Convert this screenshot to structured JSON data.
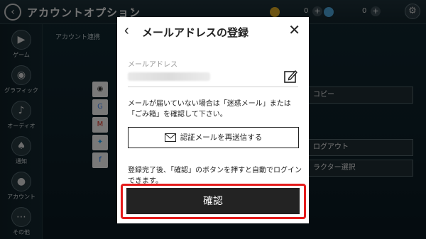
{
  "background": {
    "page_title": "アカウントオプション",
    "help_mark": "?",
    "currency": [
      {
        "icon": "gold-coin-icon",
        "value": "0"
      },
      {
        "icon": "gem-icon",
        "value": "0"
      }
    ],
    "sidebar": [
      {
        "icon": "gamepad-icon",
        "label": "ゲーム"
      },
      {
        "icon": "palette-icon",
        "label": "グラフィック"
      },
      {
        "icon": "speaker-icon",
        "label": "オーディオ"
      },
      {
        "icon": "bell-icon",
        "label": "通知"
      },
      {
        "icon": "account-icon",
        "label": "アカウント"
      },
      {
        "icon": "more-icon",
        "label": "その他"
      }
    ],
    "section_label": "アカウント連携",
    "services": [
      "apple-icon",
      "google-icon",
      "gmail-icon",
      "twitter-icon",
      "facebook-icon"
    ],
    "right_buttons": [
      "コピー",
      "ログアウト",
      "ラクター選択"
    ]
  },
  "modal": {
    "title": "メールアドレスの登録",
    "field_label": "メールアドレス",
    "email_value": "",
    "notice": "メールが届いていない場合は「迷惑メール」または「ごみ箱」を確認して下さい。",
    "resend_label": "認証メールを再送信する",
    "after_text": "登録完了後、「確認」のボタンを押すと自動でログインできます。",
    "confirm_label": "確認"
  },
  "colors": {
    "highlight": "#e41b1b",
    "confirm_bg": "#232323"
  }
}
